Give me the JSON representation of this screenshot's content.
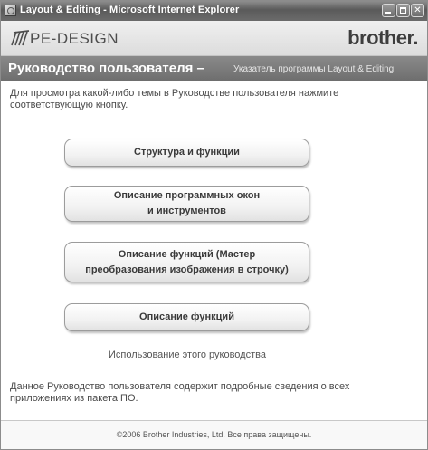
{
  "window": {
    "title": "Layout & Editing - Microsoft Internet Explorer",
    "icon": "ie-icon",
    "controls": [
      "minimize",
      "maximize",
      "close"
    ]
  },
  "header": {
    "product_logo": "PE-DESIGN",
    "brand_logo": "brother."
  },
  "section": {
    "title": "Руководство пользователя –",
    "subtitle": "Указатель программы Layout & Editing"
  },
  "intro": {
    "text": "Для просмотра какой-либо темы в Руководстве пользователя нажмите соответствующую кнопку."
  },
  "buttons": [
    {
      "lines": [
        "Структура и функции"
      ]
    },
    {
      "lines": [
        "Описание программных окон",
        "и инструментов"
      ]
    },
    {
      "lines": [
        "Описание функций (Мастер",
        "преобразования изображения в строчку)"
      ]
    },
    {
      "lines": [
        "Описание функций"
      ]
    }
  ],
  "help_link": {
    "label": "Использование этого руководства"
  },
  "outro": {
    "text": "Данное Руководство пользователя содержит подробные сведения о всех приложениях из пакета ПО."
  },
  "footer": {
    "copyright": "©2006 Brother Industries, Ltd. Все права защищены."
  },
  "colors": {
    "titlebar": "#6b6b6b",
    "section_bar": "#7a7a7a",
    "button_border": "#9c9c9c"
  }
}
